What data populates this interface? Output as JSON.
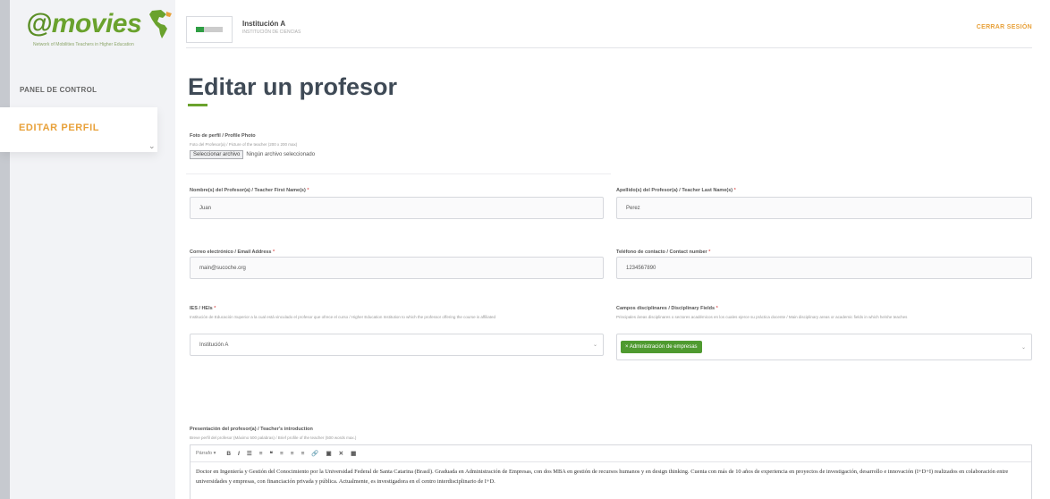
{
  "sidebar": {
    "logo_text": "movies",
    "logo_tagline": "Network of Mobilities Teachers in Higher Education",
    "nav_panel": "PANEL DE CONTROL",
    "nav_active": "EDITAR PERFIL"
  },
  "header": {
    "institution_name": "Institución A",
    "institution_sub": "INSTITUCIÓN DE CIENCIAS",
    "logout": "CERRAR SESIÓN"
  },
  "page": {
    "title": "Editar un profesor"
  },
  "form": {
    "photo": {
      "label": "Foto de perfil / Profile Photo",
      "hint": "Foto del Profesor(a) / Picture of the teacher (200 x 200 max)",
      "button": "Seleccionar archivo",
      "status": "Ningún archivo seleccionado"
    },
    "first_name": {
      "label": "Nombre(s) del Profesor(a) / Teacher First Name(s)",
      "value": "Juan"
    },
    "last_name": {
      "label": "Apellido(s) del Profesor(a) / Teacher Last Name(s)",
      "value": "Perez"
    },
    "email": {
      "label": "Correo electrónico / Email Address",
      "value": "main@sucoche.org"
    },
    "phone": {
      "label": "Teléfono de contacto / Contact number",
      "value": "1234567890"
    },
    "hei": {
      "label": "IES / HEIs",
      "hint": "Institución de Educación Superior a la cual está vinculado el profesor que ofrece el curso / Higher Education Institution to which the professor offering the course is affiliated",
      "value": "Institución A"
    },
    "fields": {
      "label": "Campos disciplinares / Disciplinary Fields",
      "hint": "Principales áreas disciplinares o sectores académicos en los cuales ejerce su práctica docente / Main disciplinary areas or academic fields in which he/she teaches",
      "tag": "× Administración de empresas"
    },
    "intro": {
      "label": "Presentación del profesor(a) / Teacher's introduction",
      "hint": "Breve perfil del profesor (Máximo 500 palabras) / Brief profile of the teacher (500 words max.)",
      "format": "Párrafo",
      "text": "Doctor en Ingeniería y Gestión del Conocimiento por la Universidad Federal de Santa Catarina (Brasil). Graduada en Administración de Empresas, con dos MBA en gestión de recursos humanos y en design thinking. Cuenta con más de 10 años de experiencia en proyectos de investigación, desarrollo e innovación (I+D+I) realizados en colaboración entre universidades y empresas, con financiación privada y pública. Actualmente, es investigadora en el centro interdisciplinario de I+D."
    }
  },
  "icons": {
    "required": "*",
    "caret": "⌄",
    "chevron": "⌄"
  }
}
